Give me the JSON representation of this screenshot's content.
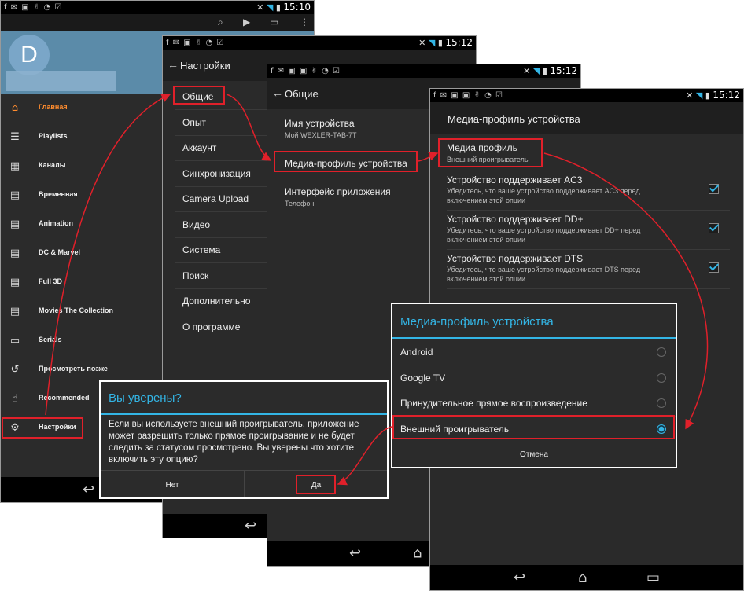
{
  "screen1": {
    "status": {
      "icons": "f ✉ ▣ ✌ ◔ ☑",
      "time": "15:10"
    },
    "avatar_letter": "D",
    "drawer": [
      {
        "icon": "home-icon",
        "glyph": "⌂",
        "label": "Главная",
        "active": true
      },
      {
        "icon": "list-icon",
        "glyph": "☰",
        "label": "Playlists"
      },
      {
        "icon": "grid-icon",
        "glyph": "▦",
        "label": "Каналы"
      },
      {
        "icon": "film-icon",
        "glyph": "▤",
        "label": "Временная"
      },
      {
        "icon": "film-icon",
        "glyph": "▤",
        "label": "Animation"
      },
      {
        "icon": "film-icon",
        "glyph": "▤",
        "label": "DC & Marvel"
      },
      {
        "icon": "film-icon",
        "glyph": "▤",
        "label": "Full 3D"
      },
      {
        "icon": "film-icon",
        "glyph": "▤",
        "label": "Movies The Collection"
      },
      {
        "icon": "tv-icon",
        "glyph": "▭",
        "label": "Serials"
      },
      {
        "icon": "history-icon",
        "glyph": "↺",
        "label": "Просмотреть позже"
      },
      {
        "icon": "thumbs-up-icon",
        "glyph": "☝",
        "label": "Recommended"
      },
      {
        "icon": "gear-icon",
        "glyph": "⚙",
        "label": "Настройки"
      }
    ]
  },
  "screen2": {
    "status": {
      "icons": "f ✉ ▣ ✌ ◔ ☑",
      "time": "15:12"
    },
    "title": "Настройки",
    "items": [
      "Общие",
      "Опыт",
      "Аккаунт",
      "Синхронизация",
      "Camera Upload",
      "Видео",
      "Система",
      "Поиск",
      "Дополнительно",
      "О программе"
    ]
  },
  "screen3": {
    "status": {
      "icons": "f ✉ ▣ ▣ ✌ ◔ ☑",
      "time": "15:12"
    },
    "title": "Общие",
    "items": [
      {
        "label": "Имя устройства",
        "sub": "Мой WEXLER-TAB-7T"
      },
      {
        "label": "Медиа-профиль устройства",
        "sub": ""
      },
      {
        "label": "Интерфейс приложения",
        "sub": "Телефон"
      }
    ]
  },
  "screen4": {
    "status": {
      "icons": "f ✉ ▣ ▣ ✌ ◔ ☑",
      "time": "15:12"
    },
    "title": "Медиа-профиль устройства",
    "profile": {
      "label": "Медиа профиль",
      "sub": "Внешний проигрыватель"
    },
    "options": [
      {
        "label": "Устройство поддерживает AC3",
        "sub1": "Убедитесь, что ваше устройство поддерживает AC3 перед",
        "sub2": "включением этой опции"
      },
      {
        "label": "Устройство поддерживает DD+",
        "sub1": "Убедитесь, что ваше устройство поддерживает DD+ перед",
        "sub2": "включением этой опции"
      },
      {
        "label": "Устройство поддерживает DTS",
        "sub1": "Убедитесь, что ваше устройство поддерживает DTS перед",
        "sub2": "включением этой опции"
      }
    ]
  },
  "profile_dialog": {
    "title": "Медиа-профиль устройства",
    "options": [
      "Android",
      "Google TV",
      "Принудительное прямое воспроизведение",
      "Внешний проигрыватель"
    ],
    "selected_index": 3,
    "cancel": "Отмена"
  },
  "confirm_dialog": {
    "title": "Вы уверены?",
    "message": "Если вы используете внешний проигрыватель, приложение может разрешить только прямое проигрывание и не будет следить за статусом просмотрено. Вы уверены что хотите включить эту опцию?",
    "no": "Нет",
    "yes": "Да"
  },
  "colors": {
    "accent": "#33b5e5",
    "highlight": "#e0202a",
    "active": "#ff8c2e"
  }
}
